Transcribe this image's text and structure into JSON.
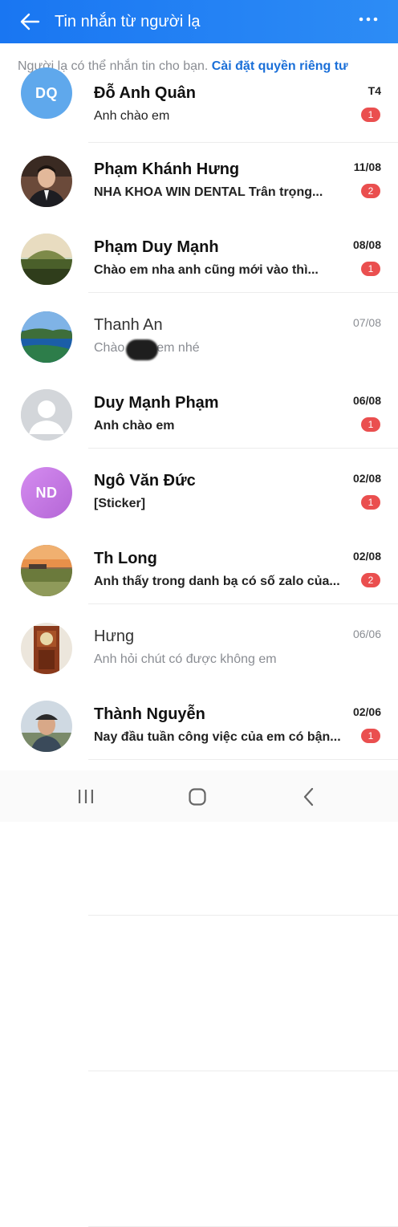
{
  "header": {
    "title": "Tin nhắn từ người lạ"
  },
  "notice": {
    "text": "Người lạ có thể nhắn tin cho bạn. ",
    "link": "Cài đặt quyền riêng tư"
  },
  "conversations": [
    {
      "name": "Đỗ Anh Quân",
      "message": "Anh chào em",
      "date": "T4",
      "unread": "1",
      "avatar": "initials",
      "initials": "DQ",
      "avatar_color": "#5fa8ec"
    },
    {
      "name": "Phạm Khánh Hưng",
      "message": "NHA KHOA WIN DENTAL Trân trọng...",
      "date": "11/08",
      "unread": "2",
      "avatar": "photo-man-suit"
    },
    {
      "name": "Phạm Duy Mạnh",
      "message": "Chào em nha anh cũng mới vào thì...",
      "date": "08/08",
      "unread": "1",
      "avatar": "photo-landscape-dome"
    },
    {
      "name": "Thanh An",
      "message": "Chào em nhé",
      "message_start": "Chào",
      "message_end": "em nhé",
      "date": "07/08",
      "unread": "",
      "avatar": "photo-landscape-lake"
    },
    {
      "name": "Duy Mạnh Phạm",
      "message": "Anh chào em",
      "date": "06/08",
      "unread": "1",
      "avatar": "default-user"
    },
    {
      "name": "Ngô Văn Đức",
      "message": "[Sticker]",
      "date": "02/08",
      "unread": "1",
      "avatar": "initials",
      "initials": "ND",
      "avatar_color": "#c77ce2"
    },
    {
      "name": "Th Long",
      "message": "Anh thấy trong danh bạ có số zalo của...",
      "date": "02/08",
      "unread": "2",
      "avatar": "photo-sunset-field"
    },
    {
      "name": "Hưng",
      "message": "Anh hỏi chút có được không em",
      "date": "06/06",
      "unread": "",
      "avatar": "photo-wooden-clock"
    },
    {
      "name": "Thành Nguyễn",
      "message": "Nay đầu tuần công việc của em có bận...",
      "date": "02/06",
      "unread": "1",
      "avatar": "photo-man-cap"
    }
  ],
  "icons": {
    "back": "arrow-left-icon",
    "more": "more-horizontal-icon",
    "nav_recent": "recent-apps-icon",
    "nav_home": "home-icon",
    "nav_back": "back-chevron-icon"
  },
  "colors": {
    "header": "#1976f2",
    "badge": "#ea4f4f",
    "link": "#1a6fd8"
  }
}
